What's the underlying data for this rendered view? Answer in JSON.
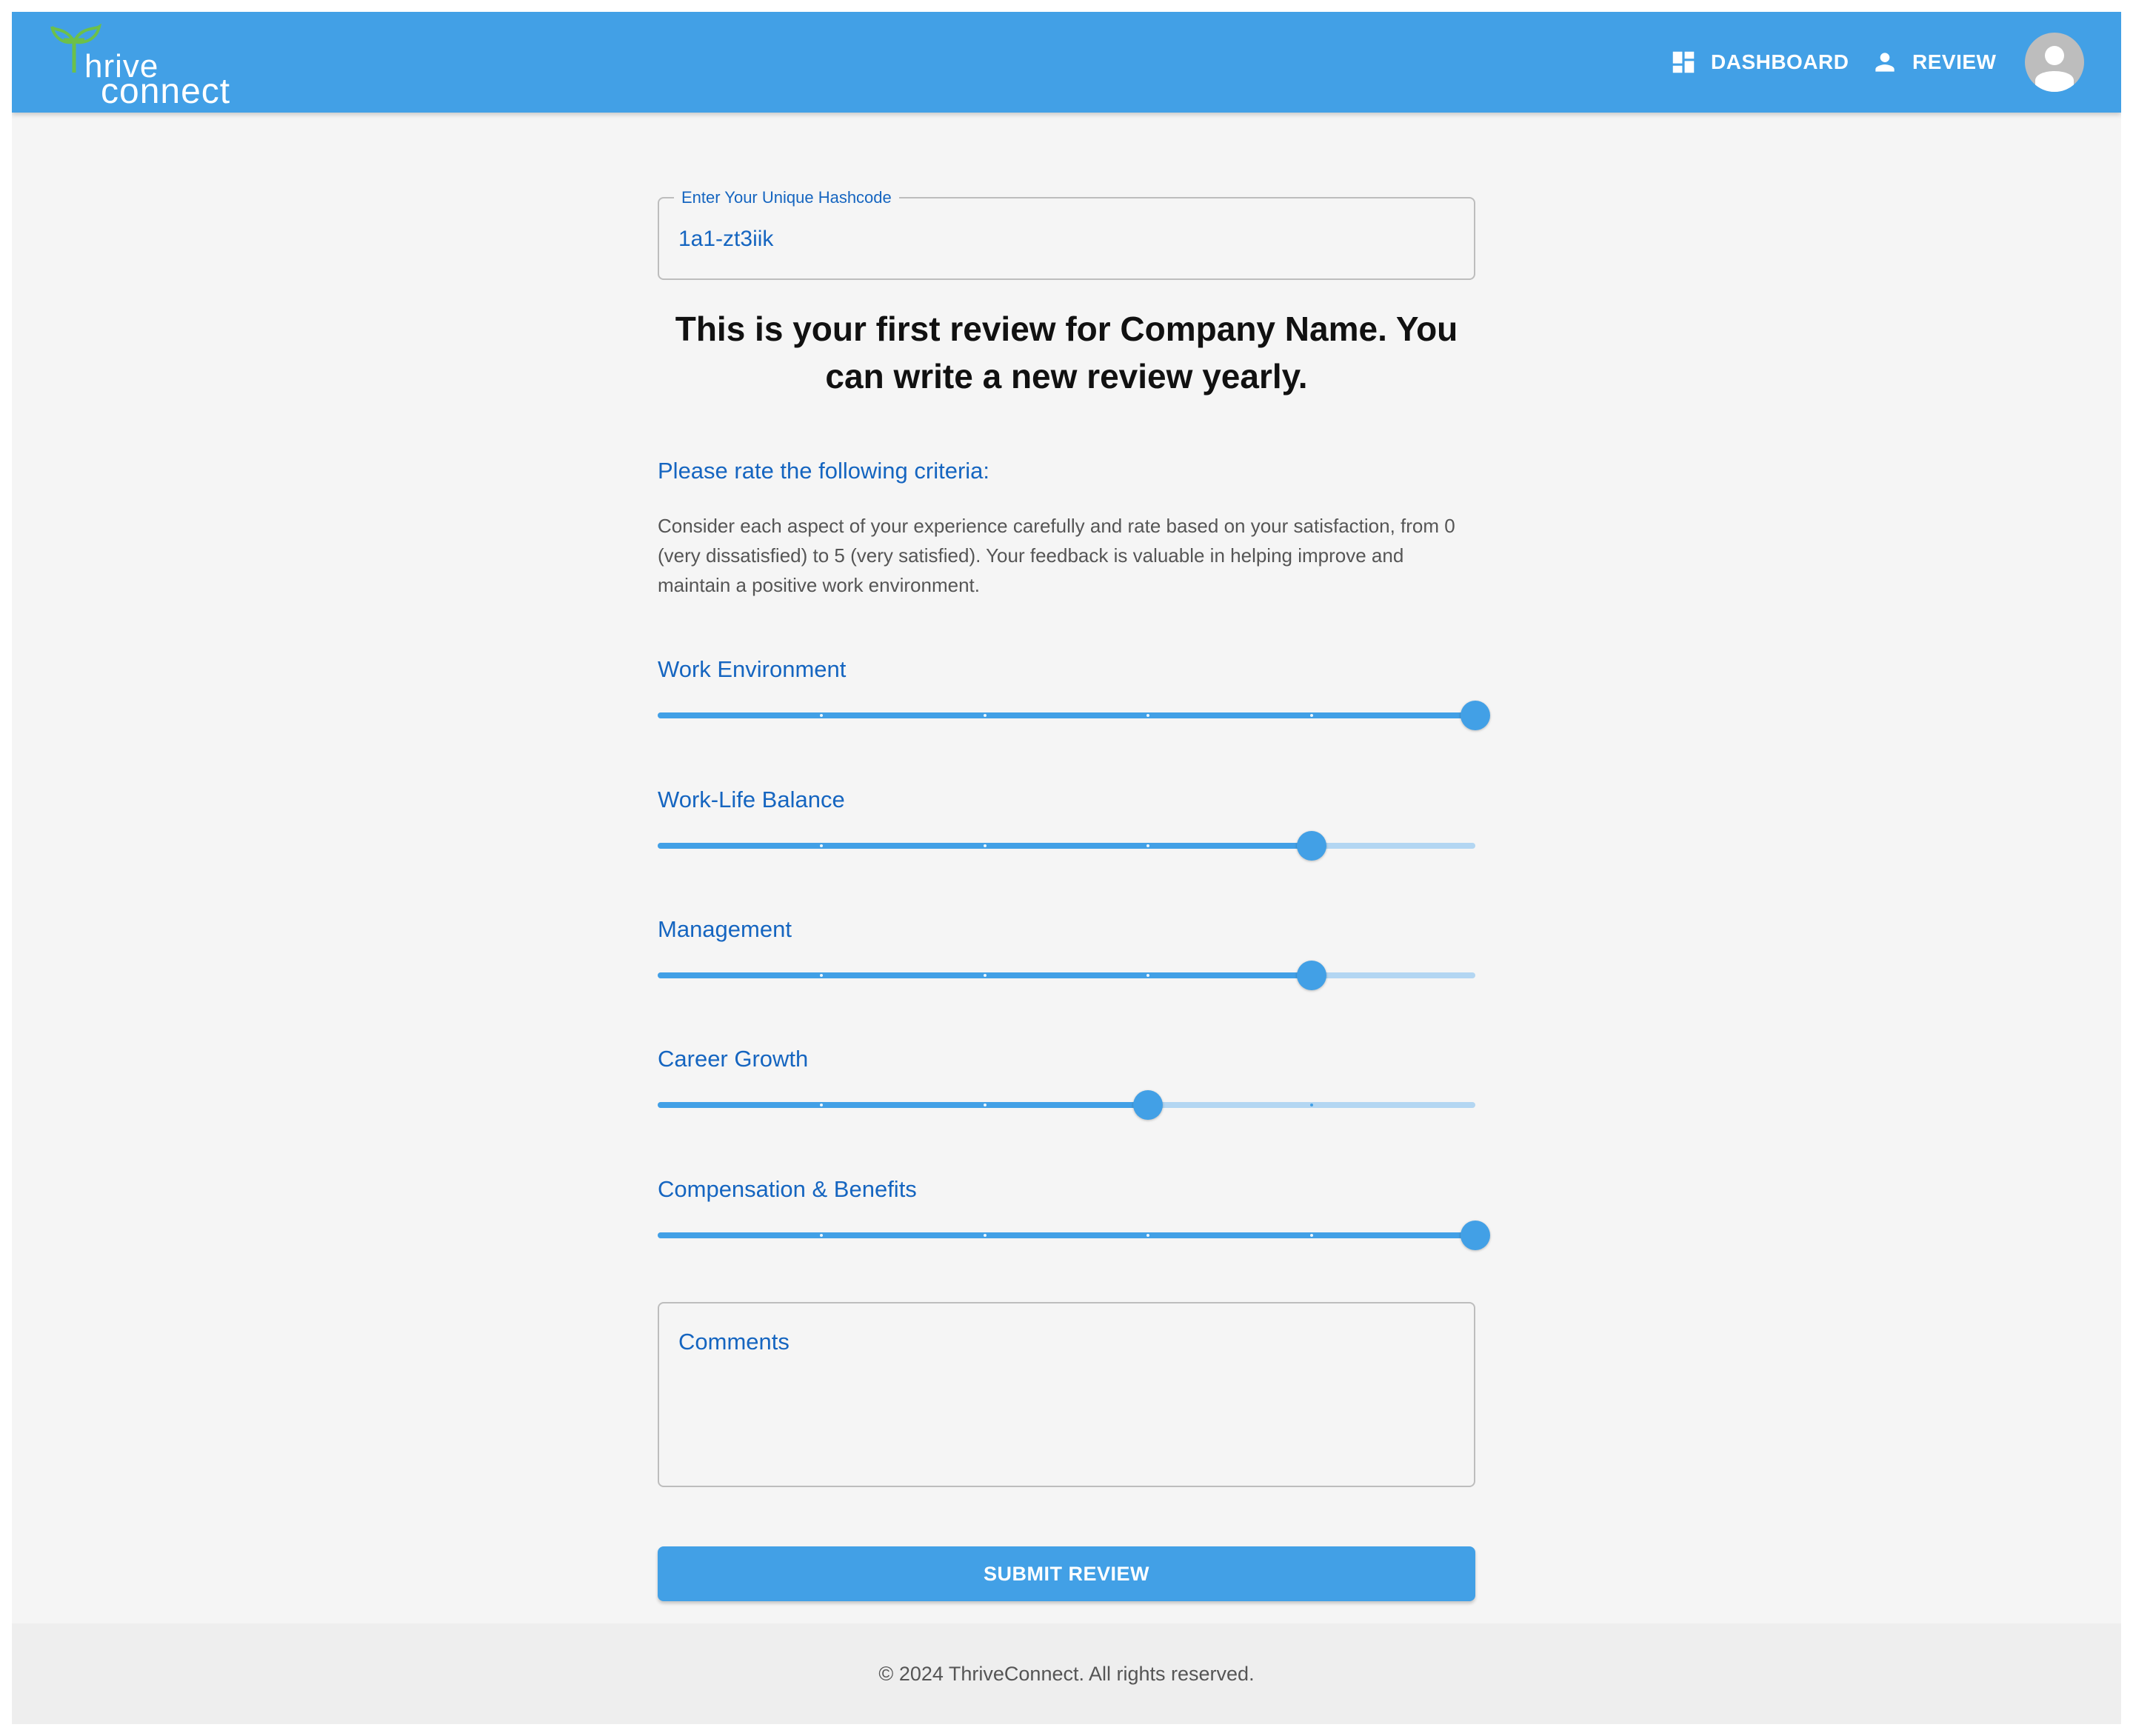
{
  "header": {
    "logo": {
      "line1": "hrive",
      "line2": "connect"
    },
    "nav": [
      {
        "label": "DASHBOARD",
        "icon": "dashboard-icon"
      },
      {
        "label": "REVIEW",
        "icon": "person-icon"
      }
    ],
    "avatar_icon": "account-circle-icon"
  },
  "form": {
    "hashcode": {
      "label": "Enter Your Unique Hashcode",
      "value": "1a1-zt3iik"
    },
    "intro": "This is your first review for Company Name. You can write a new review yearly.",
    "criteria_title": "Please rate the following criteria:",
    "criteria_description": "Consider each aspect of your experience carefully and rate based on your satisfaction, from 0 (very dissatisfied) to 5 (very satisfied). Your feedback is valuable in helping improve and maintain a positive work environment.",
    "scale": {
      "min": 0,
      "max": 5,
      "step": 1
    },
    "ratings": [
      {
        "label": "Work Environment",
        "value": 5
      },
      {
        "label": "Work-Life Balance",
        "value": 4
      },
      {
        "label": "Management",
        "value": 4
      },
      {
        "label": "Career Growth",
        "value": 3
      },
      {
        "label": "Compensation & Benefits",
        "value": 5
      }
    ],
    "comments": {
      "label": "Comments",
      "value": ""
    },
    "submit_label": "SUBMIT REVIEW"
  },
  "footer": {
    "text": "© 2024 ThriveConnect. All rights reserved."
  },
  "colors": {
    "primary": "#42a0e6",
    "primary_light": "#b3d6f2",
    "label_blue": "#1565c0",
    "logo_green": "#6cc04a",
    "background": "#f5f5f5"
  }
}
